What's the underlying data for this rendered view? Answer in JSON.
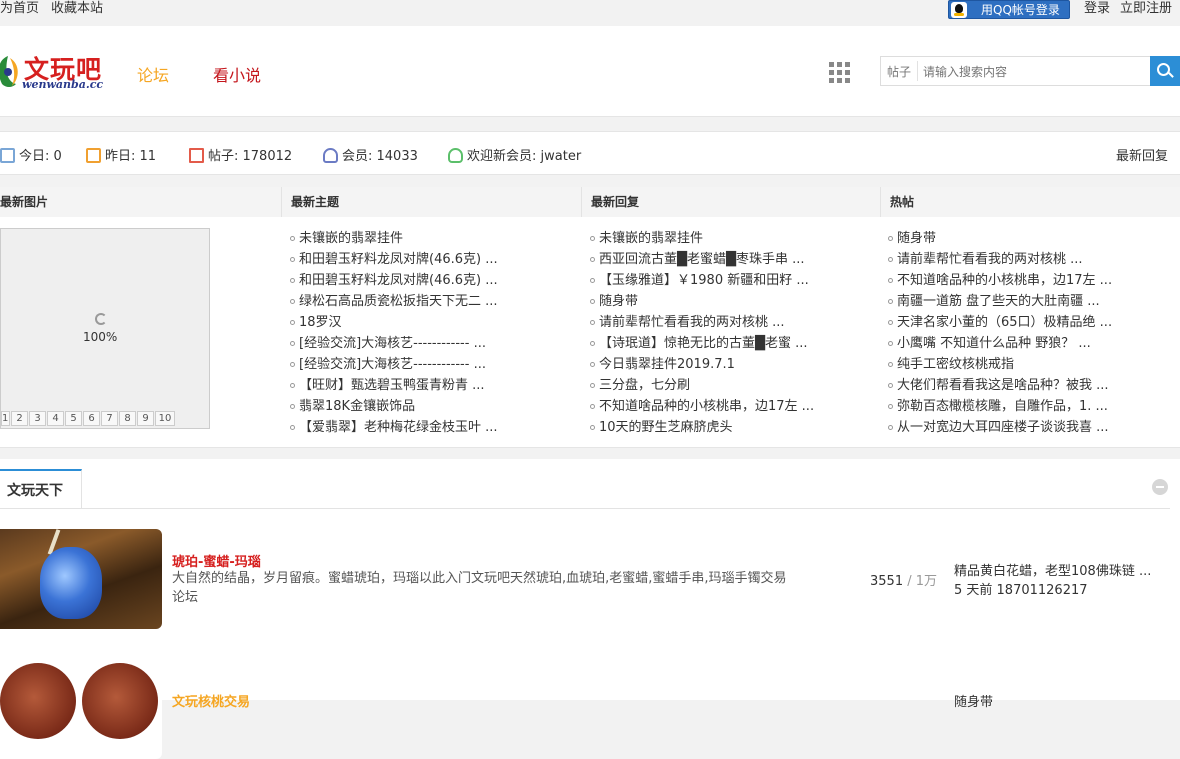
{
  "topbar": {
    "set_home": "为首页",
    "bookmark": "收藏本站",
    "qq_login": "用QQ帐号登录",
    "login": "登录",
    "register": "立即注册"
  },
  "header": {
    "logo_text": "文玩吧",
    "logo_sub": "wenwanba.cc",
    "nav": [
      "论坛",
      "看小说"
    ],
    "search": {
      "type": "帖子",
      "placeholder": "请输入搜索内容"
    }
  },
  "stats": {
    "today": "今日: 0",
    "yesterday": "昨日: 11",
    "posts": "帖子: 178012",
    "members": "会员: 14033",
    "newest": "欢迎新会员: jwater",
    "right_link": "最新回复"
  },
  "columns": {
    "images_title": "最新图片",
    "topics_title": "最新主题",
    "replies_title": "最新回复",
    "hot_title": "热帖"
  },
  "slideshow": {
    "progress": "100%",
    "pages": [
      "1",
      "2",
      "3",
      "4",
      "5",
      "6",
      "7",
      "8",
      "9",
      "10"
    ]
  },
  "latest_topics": [
    "未镶嵌的翡翠挂件",
    "和田碧玉籽料龙凤对牌(46.6克) ...",
    "和田碧玉籽料龙凤对牌(46.6克) ...",
    "绿松石高品质瓷松扳指天下无二 ...",
    "18罗汉",
    "[经验交流]大海核艺------------ ...",
    "[经验交流]大海核艺------------ ...",
    "【旺财】甄选碧玉鸭蛋青粉青 ...",
    "翡翠18K金镶嵌饰品",
    "【爱翡翠】老种梅花绿金枝玉叶 ..."
  ],
  "latest_replies": [
    "未镶嵌的翡翠挂件",
    "西亚回流古董█老蜜蜡█枣珠手串 ...",
    "【玉缘雅道】￥1980 新疆和田籽 ...",
    "随身带",
    "请前辈帮忙看看我的两对核桃 ...",
    "【诗珉道】惊艳无比的古董█老蜜 ...",
    "今日翡翠挂件2019.7.1",
    "三分盘，七分刷",
    "不知道啥品种的小核桃串，边17左 ...",
    "10天的野生芝麻脐虎头"
  ],
  "hot_posts": [
    "随身带",
    "请前辈帮忙看看我的两对核桃 ...",
    "不知道啥品种的小核桃串，边17左 ...",
    "南疆一道筋 盘了些天的大肚南疆 ...",
    "天津名家小董的（65口）极精品绝 ...",
    "小鹰嘴 不知道什么品种 野狼？ ...",
    "纯手工密纹核桃戒指",
    "大佬们帮看看我这是啥品种？被我 ...",
    "弥勒百态橄榄核雕，自雕作品，1. ...",
    "从一对宽边大耳四座楼子谈谈我喜 ..."
  ],
  "forum": {
    "section_title": "文玩天下",
    "boards": [
      {
        "title": "琥珀-蜜蜡-玛瑙",
        "desc": "大自然的结晶，岁月留痕。蜜蜡琥珀，玛瑙以此入门文玩吧天然琥珀,血琥珀,老蜜蜡,蜜蜡手串,玛瑙手镯交易论坛",
        "threads": "3551",
        "sep": " / ",
        "posts": "1万",
        "last_title": "精品黄白花蜡，老型108佛珠链 ...",
        "last_meta": "5 天前 18701126217"
      },
      {
        "title": "文玩核桃交易",
        "last_title": "随身带"
      }
    ]
  },
  "colors": {
    "brand_red": "#d6201f",
    "accent_orange": "#f5a623",
    "accent_blue": "#2c8ed6"
  }
}
